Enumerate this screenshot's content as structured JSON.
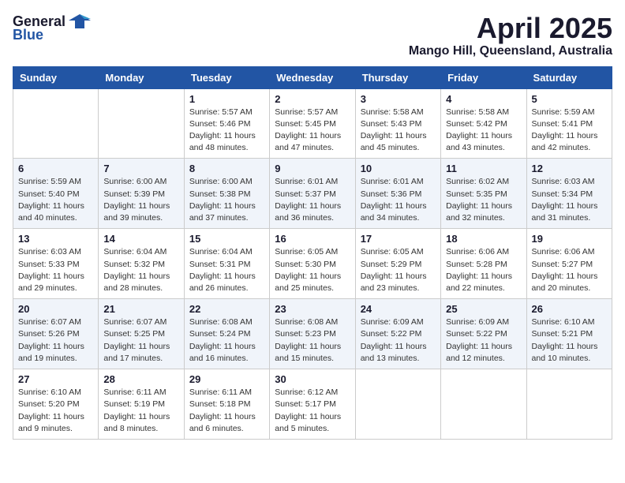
{
  "header": {
    "logo_general": "General",
    "logo_blue": "Blue",
    "month_title": "April 2025",
    "location": "Mango Hill, Queensland, Australia"
  },
  "days_of_week": [
    "Sunday",
    "Monday",
    "Tuesday",
    "Wednesday",
    "Thursday",
    "Friday",
    "Saturday"
  ],
  "weeks": [
    [
      {
        "day": "",
        "info": ""
      },
      {
        "day": "",
        "info": ""
      },
      {
        "day": "1",
        "info": "Sunrise: 5:57 AM\nSunset: 5:46 PM\nDaylight: 11 hours and 48 minutes."
      },
      {
        "day": "2",
        "info": "Sunrise: 5:57 AM\nSunset: 5:45 PM\nDaylight: 11 hours and 47 minutes."
      },
      {
        "day": "3",
        "info": "Sunrise: 5:58 AM\nSunset: 5:43 PM\nDaylight: 11 hours and 45 minutes."
      },
      {
        "day": "4",
        "info": "Sunrise: 5:58 AM\nSunset: 5:42 PM\nDaylight: 11 hours and 43 minutes."
      },
      {
        "day": "5",
        "info": "Sunrise: 5:59 AM\nSunset: 5:41 PM\nDaylight: 11 hours and 42 minutes."
      }
    ],
    [
      {
        "day": "6",
        "info": "Sunrise: 5:59 AM\nSunset: 5:40 PM\nDaylight: 11 hours and 40 minutes."
      },
      {
        "day": "7",
        "info": "Sunrise: 6:00 AM\nSunset: 5:39 PM\nDaylight: 11 hours and 39 minutes."
      },
      {
        "day": "8",
        "info": "Sunrise: 6:00 AM\nSunset: 5:38 PM\nDaylight: 11 hours and 37 minutes."
      },
      {
        "day": "9",
        "info": "Sunrise: 6:01 AM\nSunset: 5:37 PM\nDaylight: 11 hours and 36 minutes."
      },
      {
        "day": "10",
        "info": "Sunrise: 6:01 AM\nSunset: 5:36 PM\nDaylight: 11 hours and 34 minutes."
      },
      {
        "day": "11",
        "info": "Sunrise: 6:02 AM\nSunset: 5:35 PM\nDaylight: 11 hours and 32 minutes."
      },
      {
        "day": "12",
        "info": "Sunrise: 6:03 AM\nSunset: 5:34 PM\nDaylight: 11 hours and 31 minutes."
      }
    ],
    [
      {
        "day": "13",
        "info": "Sunrise: 6:03 AM\nSunset: 5:33 PM\nDaylight: 11 hours and 29 minutes."
      },
      {
        "day": "14",
        "info": "Sunrise: 6:04 AM\nSunset: 5:32 PM\nDaylight: 11 hours and 28 minutes."
      },
      {
        "day": "15",
        "info": "Sunrise: 6:04 AM\nSunset: 5:31 PM\nDaylight: 11 hours and 26 minutes."
      },
      {
        "day": "16",
        "info": "Sunrise: 6:05 AM\nSunset: 5:30 PM\nDaylight: 11 hours and 25 minutes."
      },
      {
        "day": "17",
        "info": "Sunrise: 6:05 AM\nSunset: 5:29 PM\nDaylight: 11 hours and 23 minutes."
      },
      {
        "day": "18",
        "info": "Sunrise: 6:06 AM\nSunset: 5:28 PM\nDaylight: 11 hours and 22 minutes."
      },
      {
        "day": "19",
        "info": "Sunrise: 6:06 AM\nSunset: 5:27 PM\nDaylight: 11 hours and 20 minutes."
      }
    ],
    [
      {
        "day": "20",
        "info": "Sunrise: 6:07 AM\nSunset: 5:26 PM\nDaylight: 11 hours and 19 minutes."
      },
      {
        "day": "21",
        "info": "Sunrise: 6:07 AM\nSunset: 5:25 PM\nDaylight: 11 hours and 17 minutes."
      },
      {
        "day": "22",
        "info": "Sunrise: 6:08 AM\nSunset: 5:24 PM\nDaylight: 11 hours and 16 minutes."
      },
      {
        "day": "23",
        "info": "Sunrise: 6:08 AM\nSunset: 5:23 PM\nDaylight: 11 hours and 15 minutes."
      },
      {
        "day": "24",
        "info": "Sunrise: 6:09 AM\nSunset: 5:22 PM\nDaylight: 11 hours and 13 minutes."
      },
      {
        "day": "25",
        "info": "Sunrise: 6:09 AM\nSunset: 5:22 PM\nDaylight: 11 hours and 12 minutes."
      },
      {
        "day": "26",
        "info": "Sunrise: 6:10 AM\nSunset: 5:21 PM\nDaylight: 11 hours and 10 minutes."
      }
    ],
    [
      {
        "day": "27",
        "info": "Sunrise: 6:10 AM\nSunset: 5:20 PM\nDaylight: 11 hours and 9 minutes."
      },
      {
        "day": "28",
        "info": "Sunrise: 6:11 AM\nSunset: 5:19 PM\nDaylight: 11 hours and 8 minutes."
      },
      {
        "day": "29",
        "info": "Sunrise: 6:11 AM\nSunset: 5:18 PM\nDaylight: 11 hours and 6 minutes."
      },
      {
        "day": "30",
        "info": "Sunrise: 6:12 AM\nSunset: 5:17 PM\nDaylight: 11 hours and 5 minutes."
      },
      {
        "day": "",
        "info": ""
      },
      {
        "day": "",
        "info": ""
      },
      {
        "day": "",
        "info": ""
      }
    ]
  ]
}
